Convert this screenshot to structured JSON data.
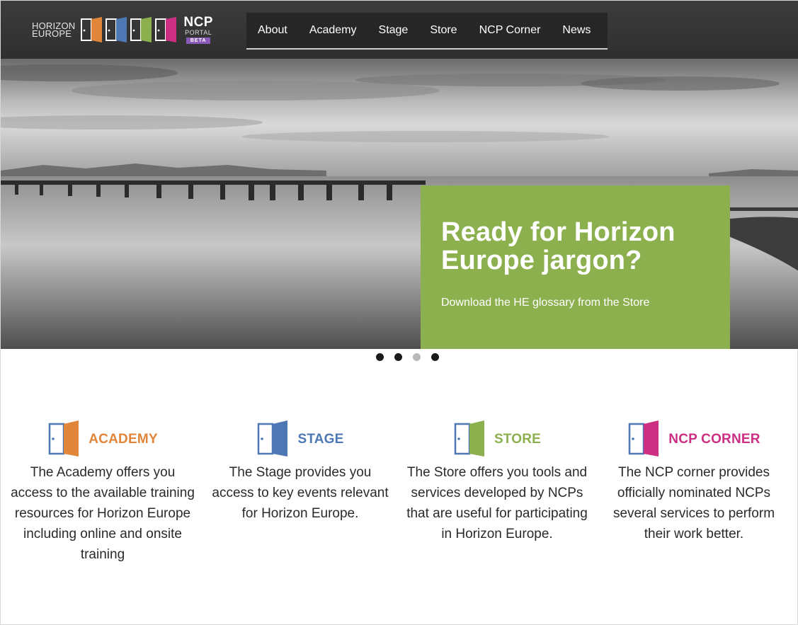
{
  "header": {
    "logo": {
      "line1": "HORIZON",
      "line2": "EUROPE",
      "ncp": "NCP",
      "portal": "PORTAL",
      "beta": "BETA"
    },
    "nav": [
      "About",
      "Academy",
      "Stage",
      "Store",
      "NCP Corner",
      "News"
    ]
  },
  "hero": {
    "title": "Ready for Horizon Europe jargon?",
    "subtitle": "Download the HE glossary from the Store",
    "accent_color": "#8db04f",
    "slider_dots": [
      {
        "active": true
      },
      {
        "active": true
      },
      {
        "active": false
      },
      {
        "active": true
      }
    ]
  },
  "features": [
    {
      "title": "ACADEMY",
      "color": "#e0853a",
      "icon": "door-icon",
      "description": "The Academy offers you access to the available training resources for Horizon Europe including online and onsite training"
    },
    {
      "title": "STAGE",
      "color": "#4d78b4",
      "icon": "door-icon",
      "description": "The Stage provides you access to key events relevant for Horizon Europe."
    },
    {
      "title": "STORE",
      "color": "#8db04f",
      "icon": "door-icon",
      "description": "The Store offers you tools and services developed by NCPs that are useful for participating in Horizon Europe."
    },
    {
      "title": "NCP CORNER",
      "color": "#cc2f82",
      "icon": "door-icon",
      "description": "The NCP corner provides officially nominated NCPs several services to perform their work better."
    }
  ]
}
